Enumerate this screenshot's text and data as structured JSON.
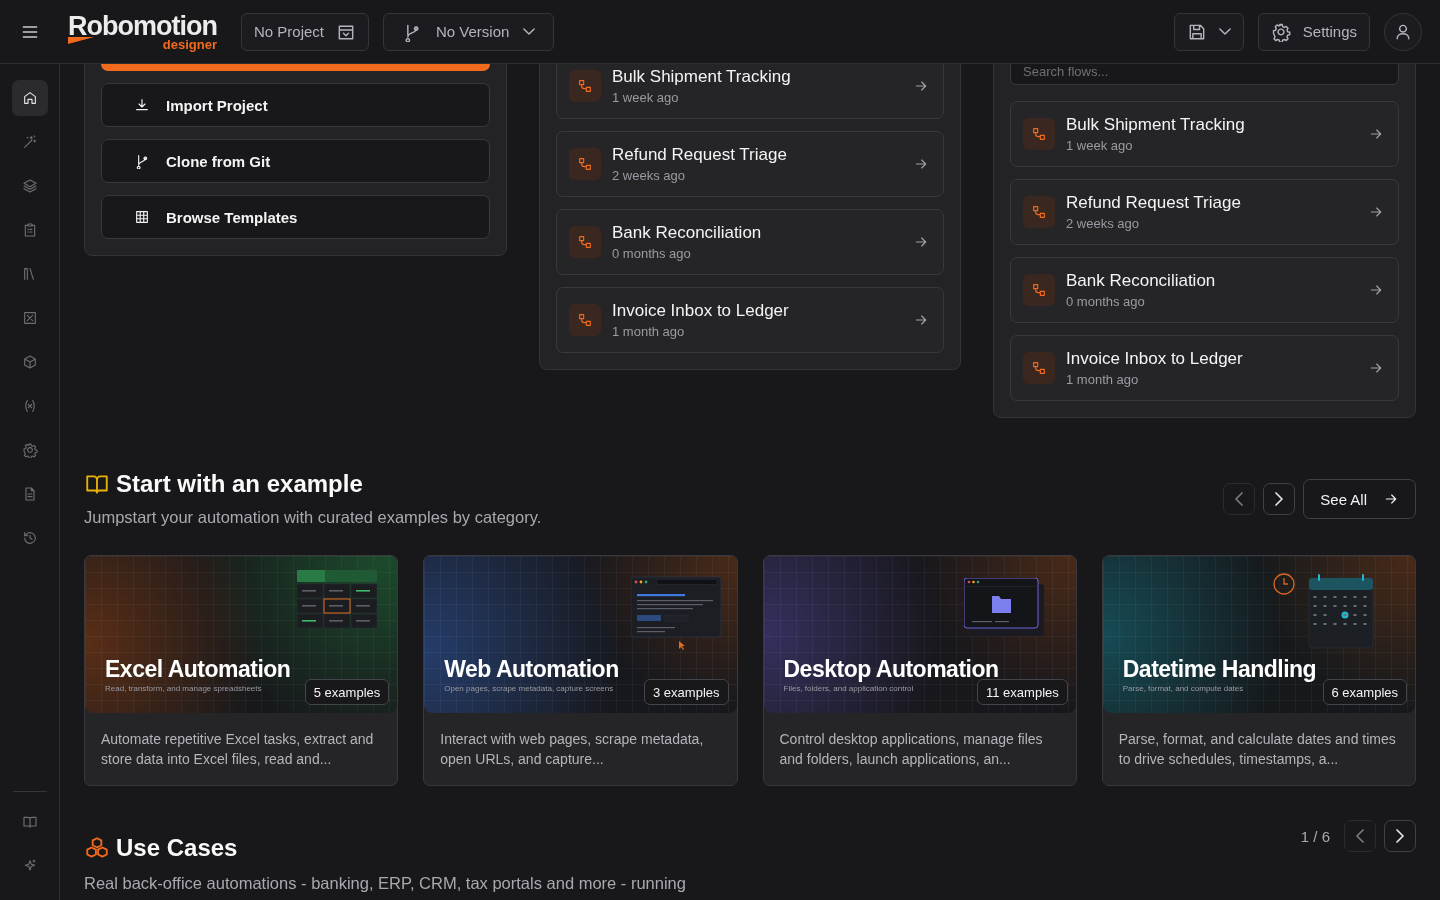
{
  "topbar": {
    "logo": {
      "name": "Robomotion",
      "tagline": "designer"
    },
    "project": "No Project",
    "version": "No Version",
    "settings": "Settings"
  },
  "sidebar": {
    "items": [
      {
        "selected": true
      },
      {
        "selected": false
      },
      {
        "selected": false
      },
      {
        "selected": false
      },
      {
        "selected": false
      },
      {
        "selected": false
      },
      {
        "selected": false
      },
      {
        "selected": false
      },
      {
        "selected": false
      },
      {
        "selected": false
      },
      {
        "selected": false
      }
    ],
    "bottom_items": [
      {
        "selected": false
      },
      {
        "selected": false
      }
    ]
  },
  "quick_actions": [
    {
      "label": "Import Project"
    },
    {
      "label": "Clone from Git"
    },
    {
      "label": "Browse Templates"
    }
  ],
  "recent_flows": [
    {
      "name": "Bulk Shipment Tracking",
      "time": "1 week ago"
    },
    {
      "name": "Refund Request Triage",
      "time": "2 weeks ago"
    },
    {
      "name": "Bank Reconciliation",
      "time": "0 months ago"
    },
    {
      "name": "Invoice Inbox to Ledger",
      "time": "1 month ago"
    }
  ],
  "flows_panel": {
    "search": {
      "placeholder": "Search flows..."
    },
    "flows": [
      {
        "name": "Bulk Shipment Tracking",
        "time": "1 week ago"
      },
      {
        "name": "Refund Request Triage",
        "time": "2 weeks ago"
      },
      {
        "name": "Bank Reconciliation",
        "time": "0 months ago"
      },
      {
        "name": "Invoice Inbox to Ledger",
        "time": "1 month ago"
      }
    ]
  },
  "examples": {
    "title": "Start with an example",
    "subtitle": "Jumpstart your automation with curated examples by category.",
    "prev": {
      "disabled": true
    },
    "next": {
      "disabled": false
    },
    "see_all": "See All",
    "cards": [
      {
        "kind": "excel",
        "title": "Excel Automation",
        "caption": "Read, transform, and manage spreadsheets",
        "count": "5 examples",
        "description": "Automate repetitive Excel tasks, extract and store data into Excel files, read and..."
      },
      {
        "kind": "web",
        "title": "Web Automation",
        "caption": "Open pages, scrape metadata, capture screens",
        "count": "3 examples",
        "description": "Interact with web pages, scrape metadata, open URLs, and capture..."
      },
      {
        "kind": "desktop",
        "title": "Desktop Automation",
        "caption": "Files, folders, and application control",
        "count": "11 examples",
        "description": "Control desktop applications, manage files and folders, launch applications, an..."
      },
      {
        "kind": "datetime",
        "title": "Datetime Handling",
        "caption": "Parse, format, and compute dates",
        "count": "6 examples",
        "description": "Parse, format, and calculate dates and times to drive schedules, timestamps, a..."
      }
    ]
  },
  "use_cases": {
    "title": "Use Cases",
    "subtitle": "Real back-office automations - banking, ERP, CRM, tax portals and more - running",
    "page": "1 / 6",
    "prev": {
      "disabled": true
    },
    "next": {
      "disabled": false
    }
  }
}
